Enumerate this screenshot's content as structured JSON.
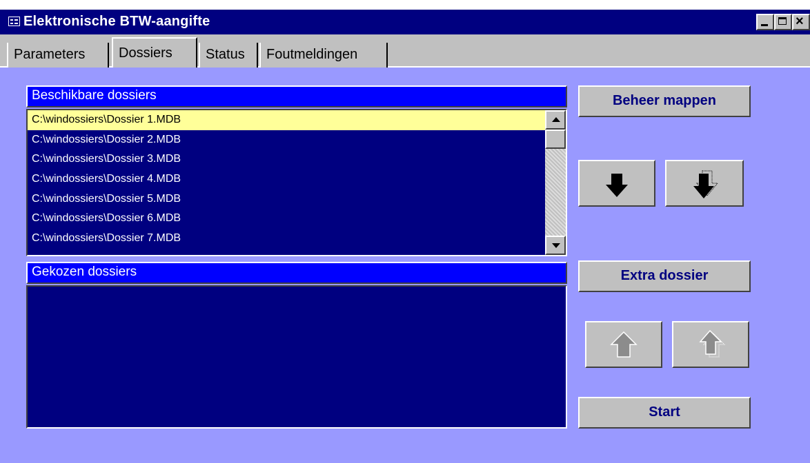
{
  "window": {
    "title": "Elektronische BTW-aangifte",
    "icon": "form-icon",
    "controls": [
      "minimize-icon",
      "maximize-icon",
      "close-icon"
    ]
  },
  "tabs": [
    {
      "label": "Parameters",
      "active": false
    },
    {
      "label": "Dossiers",
      "active": true
    },
    {
      "label": "Status",
      "active": false
    },
    {
      "label": "Foutmeldingen",
      "active": false
    }
  ],
  "available": {
    "header": "Beschikbare dossiers",
    "items": [
      "C:\\windossiers\\Dossier 1.MDB",
      "C:\\windossiers\\Dossier 2.MDB",
      "C:\\windossiers\\Dossier 3.MDB",
      "C:\\windossiers\\Dossier 4.MDB",
      "C:\\windossiers\\Dossier 5.MDB",
      "C:\\windossiers\\Dossier 6.MDB",
      "C:\\windossiers\\Dossier 7.MDB"
    ],
    "selected_item": "C:\\windossiers\\Dossier 1.MDB"
  },
  "chosen": {
    "header": "Gekozen dossiers",
    "items": []
  },
  "buttons": {
    "manage_folders": "Beheer mappen",
    "extra_dossier": "Extra dossier",
    "start": "Start",
    "add_one": {
      "icon": "arrow-down-icon",
      "enabled": true
    },
    "add_all": {
      "icon": "double-arrow-down-icon",
      "enabled": true
    },
    "remove_one": {
      "icon": "arrow-up-icon",
      "enabled": false
    },
    "remove_all": {
      "icon": "double-arrow-up-icon",
      "enabled": false
    }
  },
  "colors": {
    "form_background": "#9999ff",
    "header_blue": "#0000ff",
    "list_background": "#000080",
    "selection": "#ffff99",
    "button_text": "#000080"
  }
}
